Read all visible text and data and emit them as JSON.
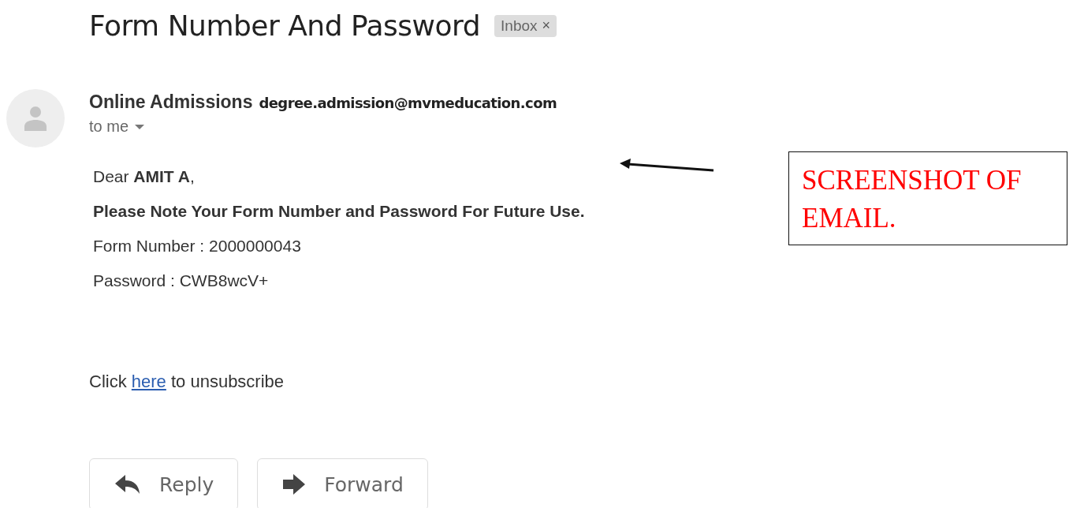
{
  "subject": "Form Number And Password",
  "label": {
    "text": "Inbox",
    "close": "×"
  },
  "sender": {
    "name": "Online Admissions",
    "email": "degree.admission@mvmeducation.com",
    "recipient": "to me"
  },
  "body": [
    "Dear **AMIT A**,",
    "Please Note Your Form Number and Password For Future Use.",
    "Form Number : 2000000043",
    "Password : CWB8wcV+"
  ],
  "body_bold": [
    false,
    true,
    false,
    false
  ],
  "unsubscribe": {
    "before": "Click",
    "link": "here",
    "after": "to unsubscribe"
  },
  "actions": [
    {
      "kind": "reply",
      "label": "Reply"
    },
    {
      "kind": "forward",
      "label": "Forward"
    }
  ],
  "annotation": {
    "text": "SCREENSHOT OF EMAIL."
  }
}
